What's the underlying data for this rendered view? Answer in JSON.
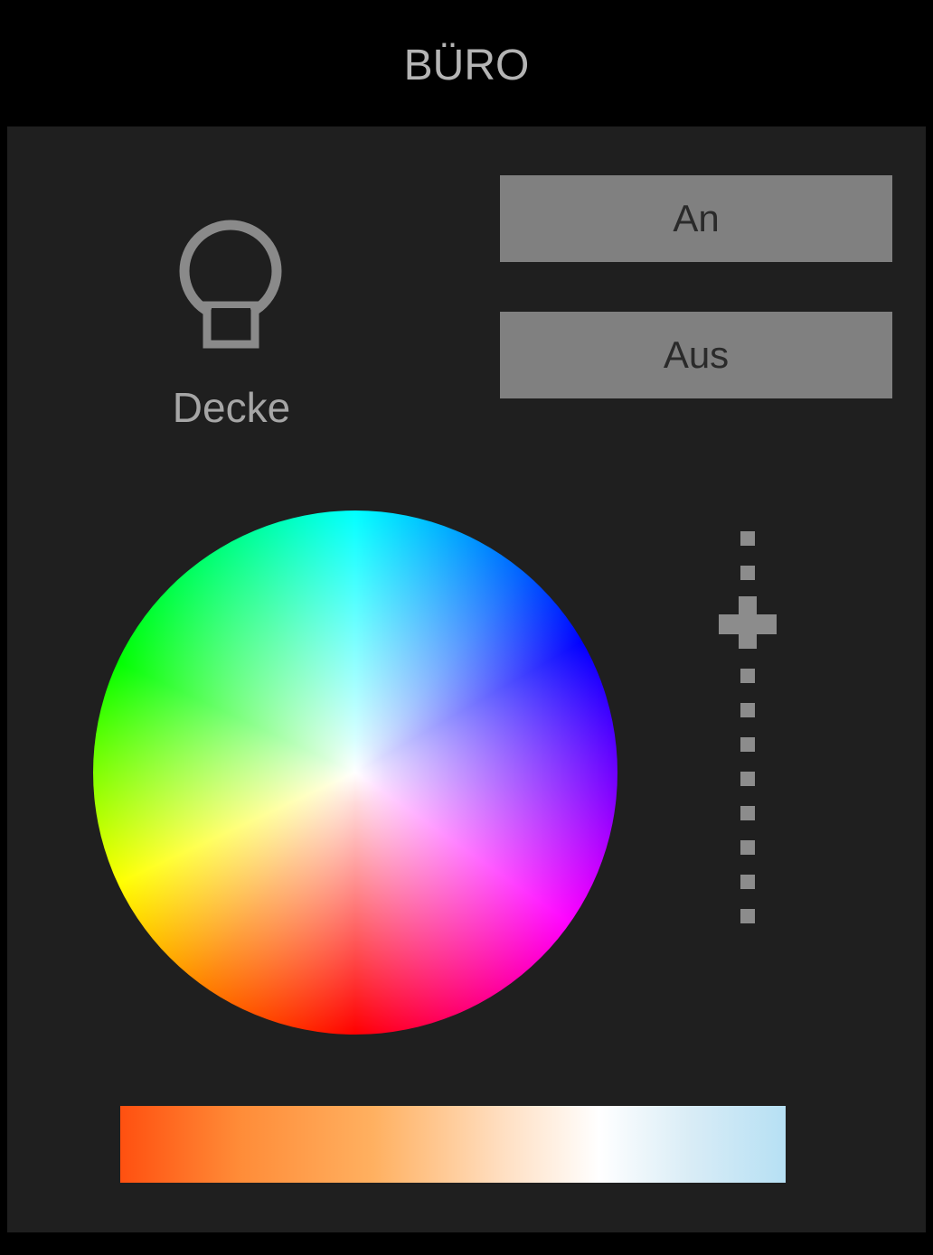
{
  "header": {
    "title": "BÜRO"
  },
  "device": {
    "label": "Decke",
    "icon": "light-bulb-icon"
  },
  "controls": {
    "on_label": "An",
    "off_label": "Aus"
  },
  "color_wheel": {
    "name": "hue-saturation-wheel"
  },
  "brightness_slider": {
    "tick_count": 12,
    "handle_position_index": 2
  },
  "color_temperature": {
    "start_color": "#ff5010",
    "middle_color": "#ffffff",
    "end_color": "#b6e0f4"
  },
  "colors": {
    "background": "#1f1f1f",
    "header_background": "#000000",
    "button_background": "#808080",
    "text": "#a6a6a6"
  }
}
